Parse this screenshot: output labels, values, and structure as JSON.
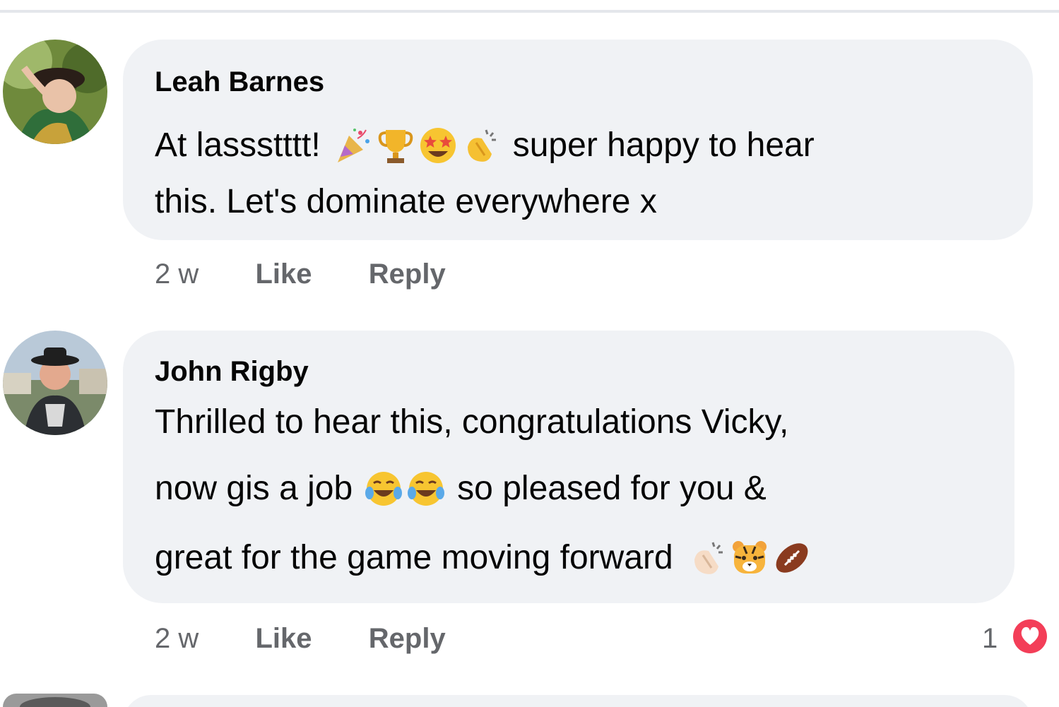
{
  "comments": [
    {
      "author": "Leah Barnes",
      "lines": [
        {
          "before": "At lassstttt!",
          "emojis": [
            "party-popper",
            "trophy",
            "star-struck",
            "clapping-hands"
          ],
          "after": "super happy to hear"
        },
        {
          "text": "this. Let's dominate everywhere x"
        }
      ],
      "time": "2 w",
      "like_label": "Like",
      "reply_label": "Reply"
    },
    {
      "author": "John Rigby",
      "lines": [
        {
          "text": "Thrilled to hear this, congratulations Vicky,"
        },
        {
          "before": "now gis a job",
          "emojis": [
            "tears-of-joy",
            "tears-of-joy"
          ],
          "after": "so pleased for you &"
        },
        {
          "before": "great for the game moving forward",
          "emojis": [
            "clapping-hands-light",
            "tiger-face",
            "rugby-ball"
          ]
        }
      ],
      "time": "2 w",
      "like_label": "Like",
      "reply_label": "Reply",
      "reactions": {
        "count": "1",
        "type": "love",
        "color": "#f33e58"
      }
    }
  ],
  "colors": {
    "bubble": "#f0f2f5",
    "meta_text": "#65676b",
    "divider": "#e4e6eb"
  }
}
